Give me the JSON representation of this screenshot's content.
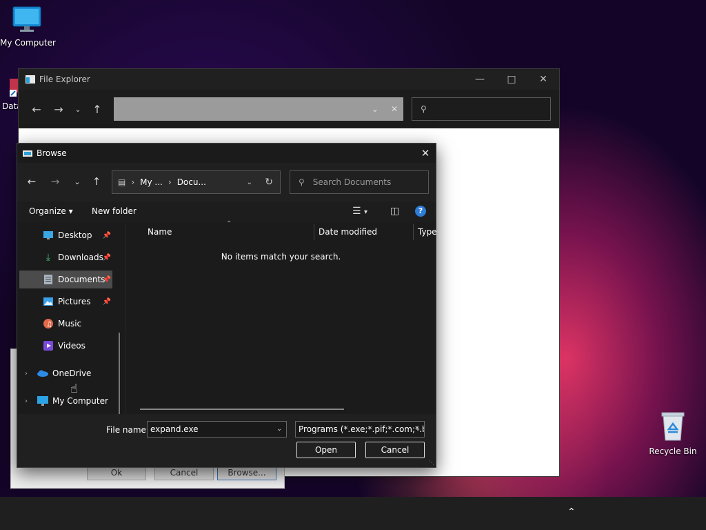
{
  "desktop": {
    "icons": [
      {
        "label": "My Computer"
      },
      {
        "label": "Data"
      },
      {
        "label": "Recycle Bin"
      }
    ]
  },
  "explorer": {
    "title": "File Explorer",
    "address_value": "",
    "search_placeholder": ""
  },
  "under_dialog": {
    "ok_label": "Ok",
    "cancel_label": "Cancel",
    "browse_label": "Browse..."
  },
  "browse": {
    "title": "Browse",
    "breadcrumb": [
      "My ...",
      "Docu..."
    ],
    "search_placeholder": "Search Documents",
    "toolbar": {
      "organize_label": "Organize",
      "new_folder_label": "New folder"
    },
    "nav_items": [
      {
        "label": "Desktop",
        "icon": "desktop-icon",
        "pinned": true
      },
      {
        "label": "Downloads",
        "icon": "download-icon",
        "pinned": true
      },
      {
        "label": "Documents",
        "icon": "document-icon",
        "pinned": true,
        "selected": true
      },
      {
        "label": "Pictures",
        "icon": "pictures-icon",
        "pinned": true
      },
      {
        "label": "Music",
        "icon": "music-icon",
        "pinned": false
      },
      {
        "label": "Videos",
        "icon": "videos-icon",
        "pinned": false
      },
      {
        "label": "OneDrive",
        "icon": "cloud-icon",
        "expandable": true
      },
      {
        "label": "My Computer",
        "icon": "computer-icon",
        "expandable": true
      }
    ],
    "columns": [
      "Name",
      "Date modified",
      "Type"
    ],
    "empty_message": "No items match your search.",
    "file_name_label": "File name:",
    "file_name_value": "expand.exe",
    "file_type_value": "Programs (*.exe;*.pif;*.com;*.bat;*.cmd)",
    "open_label": "Open",
    "cancel_label": "Cancel"
  },
  "colors": {
    "accent": "#2d7cd6",
    "dialog_bg": "#202020",
    "selection": "#4b4b4b"
  }
}
